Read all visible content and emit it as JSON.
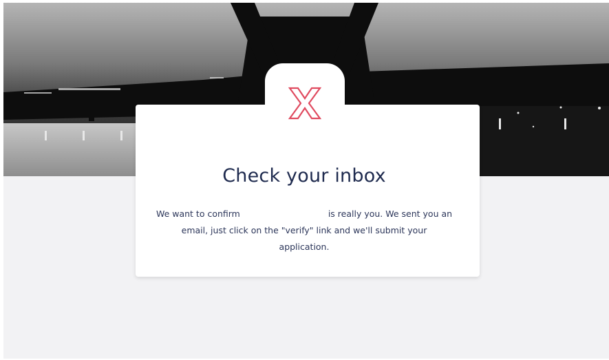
{
  "card": {
    "title": "Check your inbox",
    "message_before": "We want to confirm",
    "message_after": "is really you. We sent you an email, just click on the \"verify\" link and we'll submit your application."
  },
  "logo": {
    "icon": "x-logo-icon",
    "color": "#e04a5f"
  },
  "colors": {
    "title": "#1e2a4e",
    "body_text": "#2b3559",
    "page_background": "#f2f2f4"
  }
}
